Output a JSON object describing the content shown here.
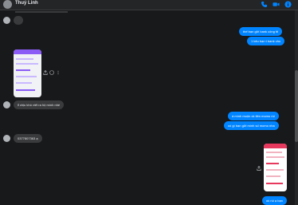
{
  "header": {
    "contact_name": "Thuý Linh",
    "icons": [
      "phone-icon",
      "video-icon",
      "info-icon"
    ]
  },
  "messages": {
    "m1_in": "",
    "m2_out": "thế bạn gửi bank công tit",
    "m3_out": "1 kêu bạn t bank cho",
    "m4_in": "lỉ chịu khó viết ra hộ mình nhé",
    "m5_out": "à mình muộn ck tiền momo rùi",
    "m6_out": "có gì bạn gửi mình số momo nha",
    "m7_in": "0377807363 ạ",
    "m8_out": "ok rùi ạ bạn"
  },
  "colors": {
    "background": "#18191a",
    "outgoing_bubble": "#0084ff",
    "incoming_bubble": "#3a3b3c",
    "accent": "#0084ff"
  }
}
